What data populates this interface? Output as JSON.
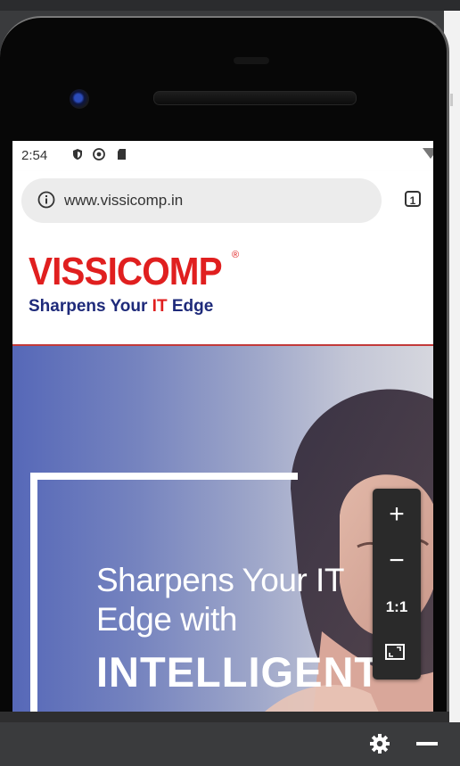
{
  "statusbar": {
    "time": "2:54",
    "icons": [
      "shield-icon",
      "sync-icon",
      "sdcard-icon",
      "wifi-icon"
    ]
  },
  "browser": {
    "url": "www.vissicomp.in",
    "tab_count": "1"
  },
  "site": {
    "logo": "VISSICOMP",
    "logo_mark": "®",
    "tagline_prefix": "Sharpens Your ",
    "tagline_it": "IT",
    "tagline_suffix": " Edge"
  },
  "hero": {
    "line1": "Sharpens Your IT",
    "line2": "Edge with",
    "big": "INTELLIGENT"
  },
  "zoom_controls": {
    "zoom_in": "+",
    "zoom_out": "−",
    "actual_size": "1:1",
    "fit_icon": "fit-screen-icon"
  },
  "emulator": {
    "settings_icon": "gear-icon",
    "minimize_icon": "minimize-icon"
  },
  "colors": {
    "brand_red": "#e01f1f",
    "brand_navy": "#1e2a7a",
    "hero_blue": "#5668b8"
  }
}
